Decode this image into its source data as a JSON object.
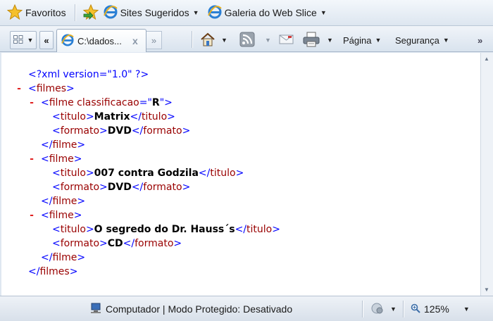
{
  "favorites_bar": {
    "favorites_label": "Favoritos",
    "items": [
      {
        "label": "Sites Sugeridos",
        "icon": "ie-icon"
      },
      {
        "label": "Galeria do Web Slice",
        "icon": "ie-icon"
      }
    ]
  },
  "tab": {
    "title": "C:\\dados...",
    "close": "x",
    "nav_back": "«",
    "nav_more": "»"
  },
  "command_bar": {
    "page_label": "Página",
    "security_label": "Segurança",
    "more": "»"
  },
  "xml": {
    "declaration": "<?xml version=\"1.0\" ?>",
    "root": "filmes",
    "attr_name": "classificacao",
    "attr_value": "R",
    "movies": [
      {
        "titulo": "Matrix",
        "formato": "DVD"
      },
      {
        "titulo": "007 contra Godzila",
        "formato": "DVD"
      },
      {
        "titulo": "O segredo do Dr. Hauss´s",
        "formato": "CD"
      }
    ]
  },
  "status_bar": {
    "zone_text": "Computador | Modo Protegido: Desativado",
    "zoom": "125%"
  },
  "colors": {
    "xml_tag": "#990000",
    "xml_bracket": "#0000ff",
    "collapse_minus": "#e02020"
  }
}
